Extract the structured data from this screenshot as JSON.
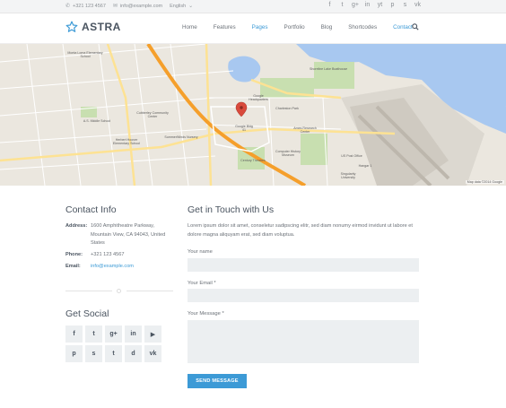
{
  "topbar": {
    "phone": "+321 123 4567",
    "email": "info@example.com",
    "language": "English",
    "socials": [
      "f",
      "t",
      "g+",
      "in",
      "yt",
      "p",
      "s",
      "vk"
    ]
  },
  "header": {
    "logo_text": "ASTRA",
    "nav": [
      "Home",
      "Features",
      "Pages",
      "Portfolio",
      "Blog",
      "Shortcodes",
      "Contact"
    ]
  },
  "map": {
    "labels": {
      "l1": "Charleston Park",
      "l2": "Google Headquarters",
      "l3": "Shoreline Lake Boathouse",
      "l4": "Monta Loma Elementary School",
      "l5": "A.S. Middle School",
      "l6": "Cubberley Community Center",
      "l7": "Herbert Hoover Elementary School",
      "l8": "SummerWinds Nursery",
      "l9": "Google Bldg 41",
      "l10": "Ames Research Center",
      "l11": "Computer History Museum",
      "l12": "US Post Office",
      "l13": "Hangar 1",
      "l14": "Singularity University",
      "l15": "Century Theatres"
    },
    "credit": "Map data ©2014 Google"
  },
  "contact": {
    "title": "Contact Info",
    "address_label": "Address:",
    "address": "1600 Amphitheatre Parkway, Mountain View, CA 94043, United States",
    "phone_label": "Phone:",
    "phone": "+321 123 4567",
    "email_label": "Email:",
    "email": "info@example.com"
  },
  "social": {
    "title": "Get Social",
    "buttons": [
      "f",
      "t",
      "g+",
      "in",
      "▶",
      "p",
      "s",
      "t",
      "d",
      "vk"
    ]
  },
  "form": {
    "title": "Get in Touch with Us",
    "intro": "Lorem ipsum dolor sit amet, conseletur sadipscing elitr, sed diam nonumy eirmod invidunt ut labore et dolore magna aliquyam erat, sed diam voluptua.",
    "name_label": "Your name",
    "email_label": "Your Email *",
    "message_label": "Your Message *",
    "submit": "SEND MESSAGE"
  },
  "colors": {
    "accent": "#3c9ad6",
    "heading": "#4a5460",
    "field_bg": "#eceff1"
  }
}
